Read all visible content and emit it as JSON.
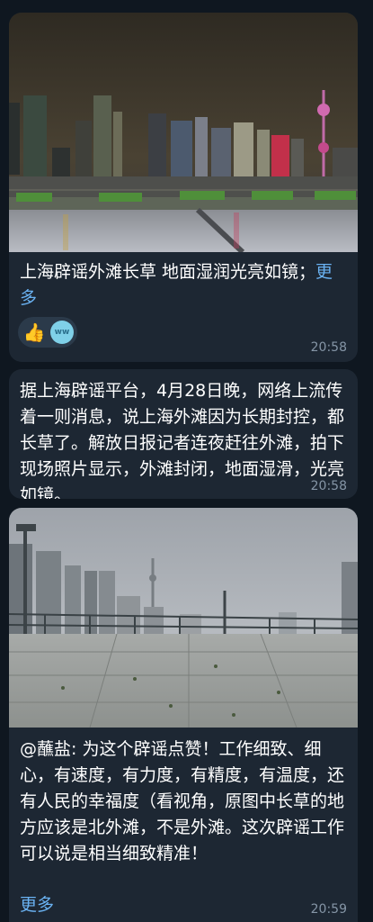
{
  "messages": [
    {
      "caption": "上海辟谣外滩长草 地面湿润光亮如镜；",
      "more": "更多",
      "reactions": {
        "emoji": "👍",
        "avatar_initials": "ww"
      },
      "time": "20:58"
    },
    {
      "text": "据上海辟谣平台，4月28日晚，网络上流传着一则消息，说上海外滩因为长期封控，都长草了。解放日报记者连夜赶往外滩，拍下现场照片显示，外滩封闭，地面湿滑，光亮如镜。",
      "time": "20:58"
    },
    {
      "caption": "@蘸盐: 为这个辟谣点赞！工作细致、细心，有速度，有力度，有精度，有温度，还有人民的幸福度（看视角，原图中长草的地方应该是北外滩，不是外滩。这次辟谣工作可以说是相当细致精准！",
      "more": "更多",
      "time": "20:59"
    }
  ]
}
